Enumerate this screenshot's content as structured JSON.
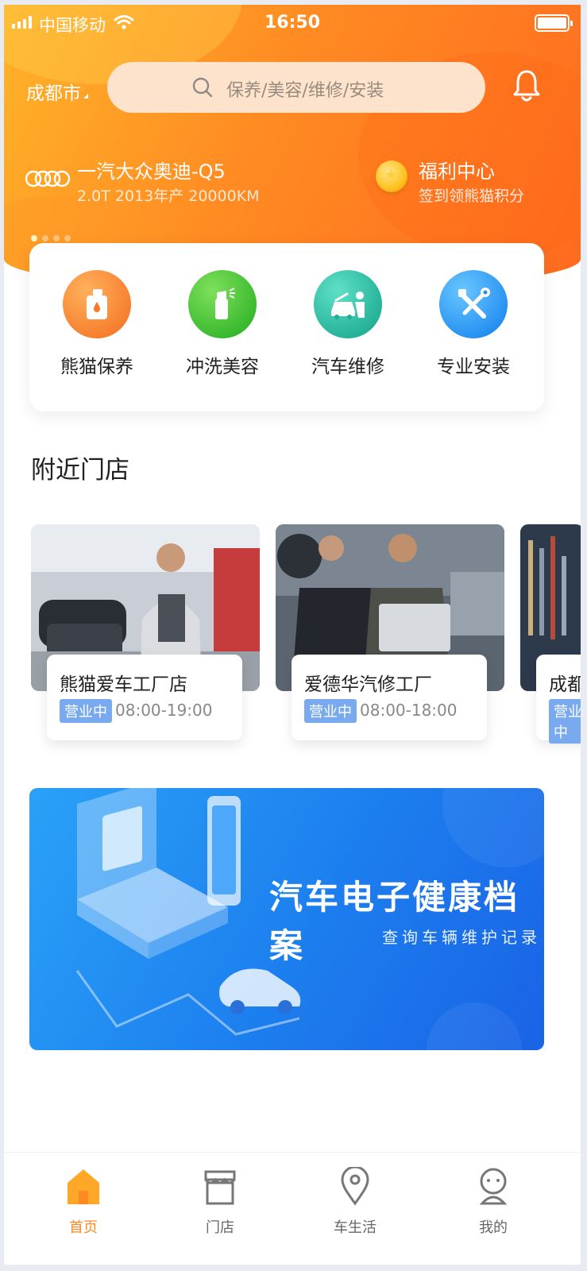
{
  "status_bar": {
    "carrier": "中国移动",
    "time": "16:50"
  },
  "header": {
    "city": "成都市",
    "search_placeholder": "保养/美容/维修/安装"
  },
  "vehicle": {
    "name": "一汽大众奥迪-Q5",
    "spec": "2.0T 2013年产 20000KM"
  },
  "welfare": {
    "title": "福利中心",
    "subtitle": "签到领熊猫积分"
  },
  "services": [
    {
      "label": "熊猫保养",
      "icon": "oil-bottle-icon",
      "color": "#f57a2a"
    },
    {
      "label": "冲洗美容",
      "icon": "spray-bottle-icon",
      "color": "#33b62a"
    },
    {
      "label": "汽车维修",
      "icon": "car-repair-icon",
      "color": "#1fae94"
    },
    {
      "label": "专业安装",
      "icon": "tools-icon",
      "color": "#1f8cf0"
    }
  ],
  "nearby": {
    "title": "附近门店",
    "shops": [
      {
        "name": "熊猫爱车工厂店",
        "status": "营业中",
        "hours": "08:00-19:00"
      },
      {
        "name": "爱德华汽修工厂",
        "status": "营业中",
        "hours": "08:00-18:00"
      },
      {
        "name": "成都",
        "status": "营业中",
        "hours": ""
      }
    ]
  },
  "banner": {
    "title": "汽车电子健康档案",
    "subtitle": "查询车辆维护记录"
  },
  "tabbar": [
    {
      "label": "首页",
      "icon": "home-icon",
      "active": true
    },
    {
      "label": "门店",
      "icon": "store-icon",
      "active": false
    },
    {
      "label": "车生活",
      "icon": "location-pin-icon",
      "active": false
    },
    {
      "label": "我的",
      "icon": "profile-icon",
      "active": false
    }
  ],
  "colors": {
    "accent": "#ff8a22",
    "open_tag": "#79a9ee",
    "banner": "#1c7eee"
  }
}
